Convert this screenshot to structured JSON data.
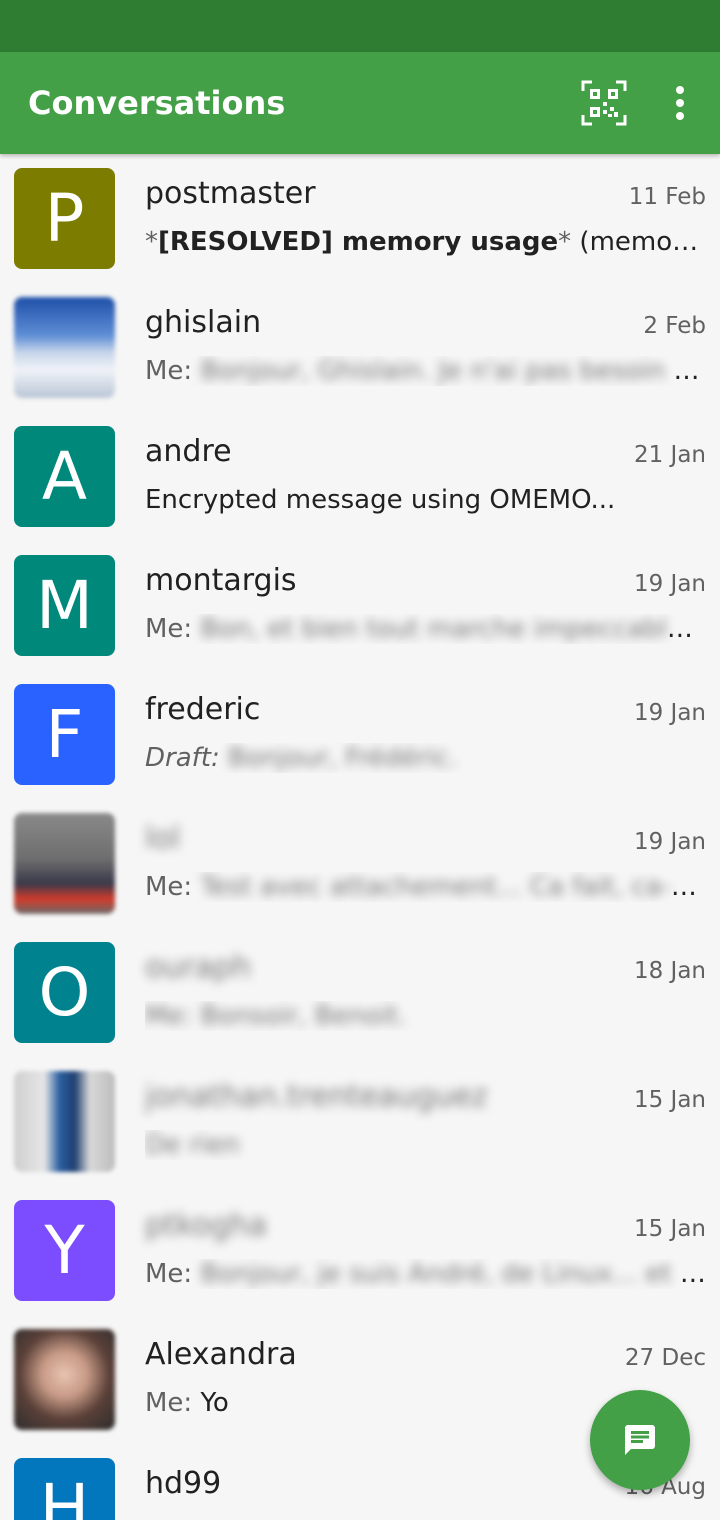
{
  "app": {
    "title": "Conversations",
    "theme": {
      "primary": "#43a047",
      "primary_dark": "#2e7d32"
    },
    "actions": {
      "qr_icon": "qr-code-scan-icon",
      "overflow_icon": "more-vert-icon"
    }
  },
  "conversations": [
    {
      "name": "postmaster",
      "date": "11 Feb",
      "avatar_letter": "P",
      "avatar_color": "#7c7c00",
      "star_open": "*",
      "preview_bold": "[RESOLVED] memory usage",
      "star_close": "*",
      "preview_rest": " (memory usage..."
    },
    {
      "name": "ghislain",
      "date": "2 Feb",
      "avatar_type": "photo",
      "prefix": "Me:",
      "preview": "Bonjour, Ghislain. Je n'ai pas besoin de..."
    },
    {
      "name": "andre",
      "date": "21 Jan",
      "avatar_letter": "A",
      "avatar_color": "#00897b",
      "preview": "Encrypted message using OMEMO..."
    },
    {
      "name": "montargis",
      "date": "19 Jan",
      "avatar_letter": "M",
      "avatar_color": "#00897b",
      "prefix": "Me:",
      "preview": "Bon, et bien tout marche impeccable..."
    },
    {
      "name": "frederic",
      "date": "19 Jan",
      "avatar_letter": "F",
      "avatar_color": "#2962ff",
      "prefix": "Draft:",
      "preview": "Bonjour, Frédéric."
    },
    {
      "name": "lol",
      "date": "19 Jan",
      "avatar_type": "photo",
      "prefix": "Me:",
      "preview": "Test avec attachement... Ca fait, ca-g..."
    },
    {
      "name": "ouraph",
      "date": "18 Jan",
      "avatar_letter": "O",
      "avatar_color": "#00838f",
      "preview": "Me: Bonsoir, Benoit."
    },
    {
      "name": "jonathan.trenteauguez",
      "date": "15 Jan",
      "avatar_type": "photo",
      "preview": "De rien"
    },
    {
      "name": "ptkogha",
      "date": "15 Jan",
      "avatar_letter": "Y",
      "avatar_color": "#7c4dff",
      "prefix": "Me:",
      "preview": "Bonjour, je suis André, de Linux... et j..."
    },
    {
      "name": "Alexandra",
      "date": "27 Dec",
      "avatar_type": "photo",
      "prefix": "Me:",
      "preview": "Yo"
    },
    {
      "name": "hd99",
      "date": "16 Aug",
      "avatar_letter": "H",
      "avatar_color": "#0277bd",
      "preview": ""
    }
  ],
  "fab": {
    "icon": "new-message-icon"
  }
}
